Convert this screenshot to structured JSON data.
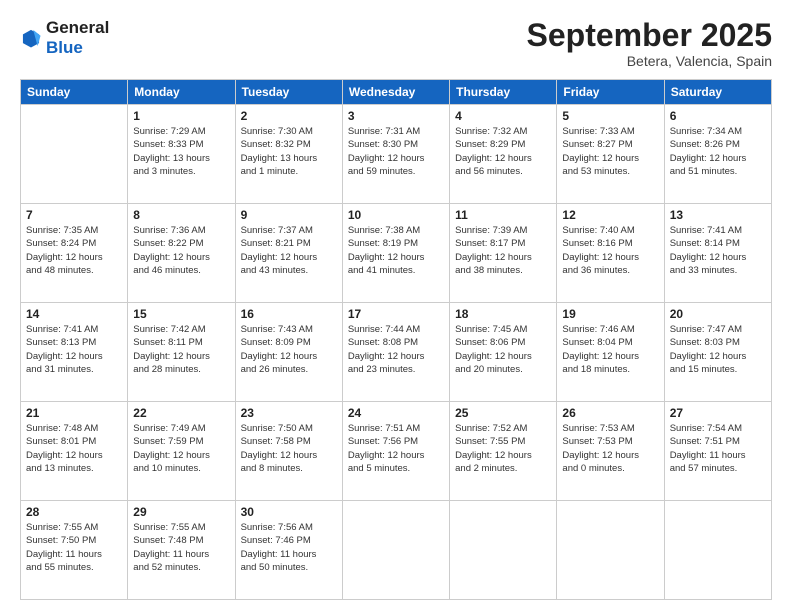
{
  "logo": {
    "general": "General",
    "blue": "Blue"
  },
  "title": "September 2025",
  "location": "Betera, Valencia, Spain",
  "days_header": [
    "Sunday",
    "Monday",
    "Tuesday",
    "Wednesday",
    "Thursday",
    "Friday",
    "Saturday"
  ],
  "weeks": [
    [
      {
        "num": "",
        "info": ""
      },
      {
        "num": "1",
        "info": "Sunrise: 7:29 AM\nSunset: 8:33 PM\nDaylight: 13 hours\nand 3 minutes."
      },
      {
        "num": "2",
        "info": "Sunrise: 7:30 AM\nSunset: 8:32 PM\nDaylight: 13 hours\nand 1 minute."
      },
      {
        "num": "3",
        "info": "Sunrise: 7:31 AM\nSunset: 8:30 PM\nDaylight: 12 hours\nand 59 minutes."
      },
      {
        "num": "4",
        "info": "Sunrise: 7:32 AM\nSunset: 8:29 PM\nDaylight: 12 hours\nand 56 minutes."
      },
      {
        "num": "5",
        "info": "Sunrise: 7:33 AM\nSunset: 8:27 PM\nDaylight: 12 hours\nand 53 minutes."
      },
      {
        "num": "6",
        "info": "Sunrise: 7:34 AM\nSunset: 8:26 PM\nDaylight: 12 hours\nand 51 minutes."
      }
    ],
    [
      {
        "num": "7",
        "info": "Sunrise: 7:35 AM\nSunset: 8:24 PM\nDaylight: 12 hours\nand 48 minutes."
      },
      {
        "num": "8",
        "info": "Sunrise: 7:36 AM\nSunset: 8:22 PM\nDaylight: 12 hours\nand 46 minutes."
      },
      {
        "num": "9",
        "info": "Sunrise: 7:37 AM\nSunset: 8:21 PM\nDaylight: 12 hours\nand 43 minutes."
      },
      {
        "num": "10",
        "info": "Sunrise: 7:38 AM\nSunset: 8:19 PM\nDaylight: 12 hours\nand 41 minutes."
      },
      {
        "num": "11",
        "info": "Sunrise: 7:39 AM\nSunset: 8:17 PM\nDaylight: 12 hours\nand 38 minutes."
      },
      {
        "num": "12",
        "info": "Sunrise: 7:40 AM\nSunset: 8:16 PM\nDaylight: 12 hours\nand 36 minutes."
      },
      {
        "num": "13",
        "info": "Sunrise: 7:41 AM\nSunset: 8:14 PM\nDaylight: 12 hours\nand 33 minutes."
      }
    ],
    [
      {
        "num": "14",
        "info": "Sunrise: 7:41 AM\nSunset: 8:13 PM\nDaylight: 12 hours\nand 31 minutes."
      },
      {
        "num": "15",
        "info": "Sunrise: 7:42 AM\nSunset: 8:11 PM\nDaylight: 12 hours\nand 28 minutes."
      },
      {
        "num": "16",
        "info": "Sunrise: 7:43 AM\nSunset: 8:09 PM\nDaylight: 12 hours\nand 26 minutes."
      },
      {
        "num": "17",
        "info": "Sunrise: 7:44 AM\nSunset: 8:08 PM\nDaylight: 12 hours\nand 23 minutes."
      },
      {
        "num": "18",
        "info": "Sunrise: 7:45 AM\nSunset: 8:06 PM\nDaylight: 12 hours\nand 20 minutes."
      },
      {
        "num": "19",
        "info": "Sunrise: 7:46 AM\nSunset: 8:04 PM\nDaylight: 12 hours\nand 18 minutes."
      },
      {
        "num": "20",
        "info": "Sunrise: 7:47 AM\nSunset: 8:03 PM\nDaylight: 12 hours\nand 15 minutes."
      }
    ],
    [
      {
        "num": "21",
        "info": "Sunrise: 7:48 AM\nSunset: 8:01 PM\nDaylight: 12 hours\nand 13 minutes."
      },
      {
        "num": "22",
        "info": "Sunrise: 7:49 AM\nSunset: 7:59 PM\nDaylight: 12 hours\nand 10 minutes."
      },
      {
        "num": "23",
        "info": "Sunrise: 7:50 AM\nSunset: 7:58 PM\nDaylight: 12 hours\nand 8 minutes."
      },
      {
        "num": "24",
        "info": "Sunrise: 7:51 AM\nSunset: 7:56 PM\nDaylight: 12 hours\nand 5 minutes."
      },
      {
        "num": "25",
        "info": "Sunrise: 7:52 AM\nSunset: 7:55 PM\nDaylight: 12 hours\nand 2 minutes."
      },
      {
        "num": "26",
        "info": "Sunrise: 7:53 AM\nSunset: 7:53 PM\nDaylight: 12 hours\nand 0 minutes."
      },
      {
        "num": "27",
        "info": "Sunrise: 7:54 AM\nSunset: 7:51 PM\nDaylight: 11 hours\nand 57 minutes."
      }
    ],
    [
      {
        "num": "28",
        "info": "Sunrise: 7:55 AM\nSunset: 7:50 PM\nDaylight: 11 hours\nand 55 minutes."
      },
      {
        "num": "29",
        "info": "Sunrise: 7:55 AM\nSunset: 7:48 PM\nDaylight: 11 hours\nand 52 minutes."
      },
      {
        "num": "30",
        "info": "Sunrise: 7:56 AM\nSunset: 7:46 PM\nDaylight: 11 hours\nand 50 minutes."
      },
      {
        "num": "",
        "info": ""
      },
      {
        "num": "",
        "info": ""
      },
      {
        "num": "",
        "info": ""
      },
      {
        "num": "",
        "info": ""
      }
    ]
  ]
}
